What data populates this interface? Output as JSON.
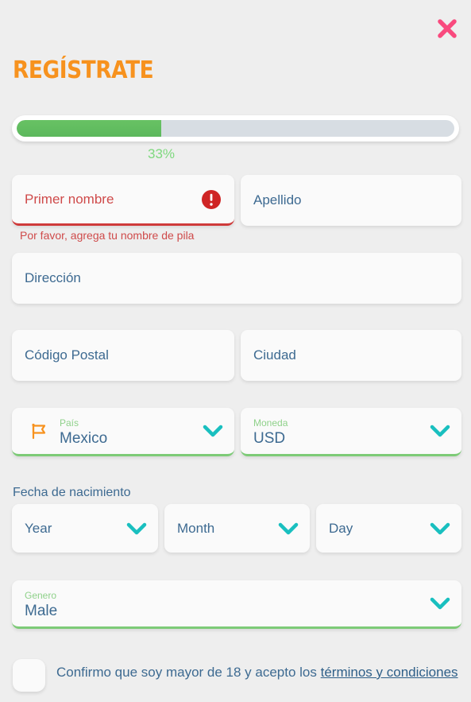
{
  "window": {
    "close_icon": "close-icon",
    "close_color": "#f94a7e",
    "background": "#eeeeee"
  },
  "header": {
    "title": "REGÍSTRATE",
    "title_color": "#f7921e"
  },
  "progress": {
    "percent_label": "33%",
    "percent_value": 33,
    "fill_color": "#5cb85c",
    "track_color": "#d7dde3",
    "label_color": "#7ed87e"
  },
  "form": {
    "first_name": {
      "placeholder": "Primer nombre",
      "value": "",
      "state": "error",
      "error_icon": "alert-circle-icon",
      "error_message": "Por favor, agrega tu nombre de pila",
      "error_color": "#cf3a3a"
    },
    "last_name": {
      "placeholder": "Apellido",
      "value": ""
    },
    "address": {
      "placeholder": "Dirección",
      "value": ""
    },
    "postal_code": {
      "placeholder": "Código Postal",
      "value": ""
    },
    "city": {
      "placeholder": "Ciudad",
      "value": ""
    },
    "country": {
      "label": "País",
      "value": "Mexico",
      "lead_icon": "flag-icon",
      "chevron": "chevron-down-icon"
    },
    "currency": {
      "label": "Moneda",
      "value": "USD",
      "chevron": "chevron-down-icon"
    },
    "dob": {
      "label": "Fecha de nacimiento",
      "year": {
        "placeholder": "Year",
        "chevron": "chevron-down-icon"
      },
      "month": {
        "placeholder": "Month",
        "chevron": "chevron-down-icon"
      },
      "day": {
        "placeholder": "Day",
        "chevron": "chevron-down-icon"
      }
    },
    "gender": {
      "label": "Genero",
      "value": "Male",
      "chevron": "chevron-down-icon"
    }
  },
  "terms": {
    "checkbox_checked": false,
    "text_before": "Confirmo que soy mayor de 18 y acepto los ",
    "link_text": "términos y condiciones"
  },
  "colors": {
    "accent_orange": "#f7921e",
    "accent_pink": "#f94a7e",
    "accent_green": "#5cb85c",
    "accent_teal": "#19bfbf",
    "text_blue": "#3d6a91",
    "error_red": "#cf3a3a",
    "card_bg": "#fafafa"
  }
}
